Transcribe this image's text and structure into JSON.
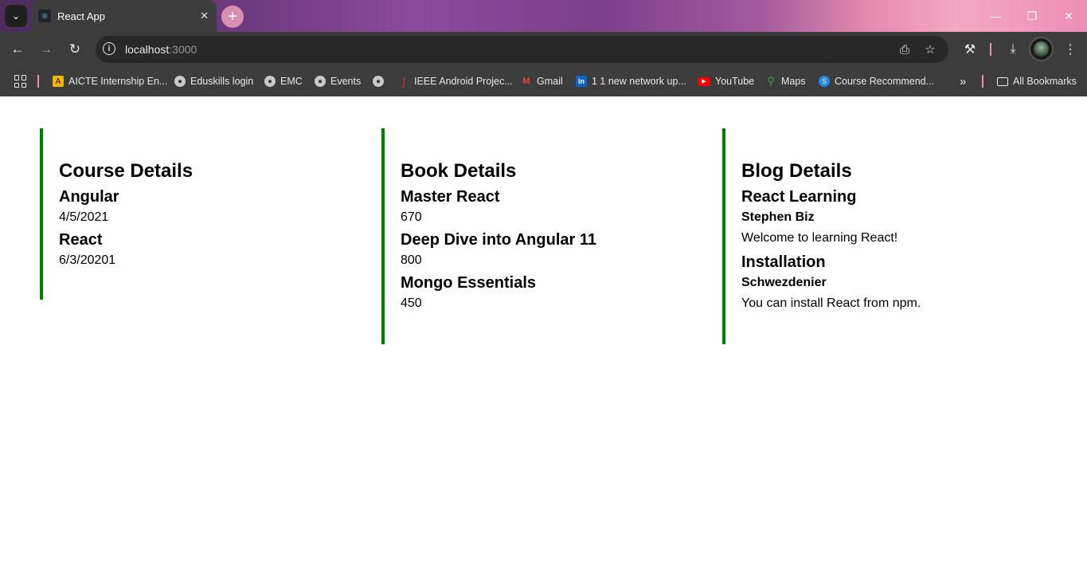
{
  "browser": {
    "tab": {
      "title": "React App"
    },
    "url": {
      "host": "localhost",
      "port": ":3000"
    },
    "bookmarks": [
      "AICTE Internship En...",
      "Eduskills login",
      "EMC",
      "Events",
      "",
      "IEEE Android Projec...",
      "Gmail",
      "1 1 new network up...",
      "YouTube",
      "Maps",
      "Course Recommend..."
    ],
    "all_bookmarks": "All Bookmarks"
  },
  "course": {
    "title": "Course Details",
    "items": [
      {
        "name": "Angular",
        "date": "4/5/2021"
      },
      {
        "name": "React",
        "date": "6/3/20201"
      }
    ]
  },
  "book": {
    "title": "Book Details",
    "items": [
      {
        "name": "Master React",
        "price": "670"
      },
      {
        "name": "Deep Dive into Angular 11",
        "price": "800"
      },
      {
        "name": "Mongo Essentials",
        "price": "450"
      }
    ]
  },
  "blog": {
    "title": "Blog Details",
    "items": [
      {
        "title": "React Learning",
        "author": "Stephen Biz",
        "text": "Welcome to learning React!"
      },
      {
        "title": "Installation",
        "author": "Schwezdenier",
        "text": "You can install React from npm."
      }
    ]
  },
  "colors": {
    "accent_border": "#008000"
  }
}
